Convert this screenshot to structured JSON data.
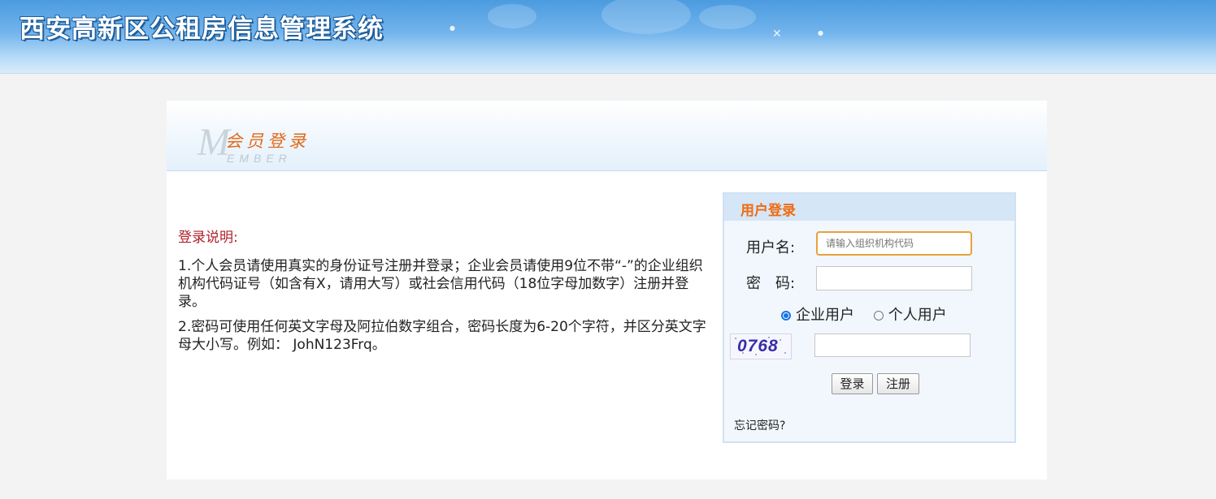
{
  "header": {
    "title": "西安高新区公租房信息管理系统"
  },
  "panel": {
    "logo_letter": "M",
    "logo_cn": "会员登录",
    "logo_en": "EMBER"
  },
  "instructions": {
    "title": "登录说明:",
    "items": [
      "1.个人会员请使用真实的身份证号注册并登录；企业会员请使用9位不带“-”的企业组织机构代码证号（如含有X，请用大写）或社会信用代码（18位字母加数字）注册并登录。",
      "2.密码可使用任何英文字母及阿拉伯数字组合，密码长度为6-20个字符，并区分英文字母大小写。例如： JohN123Frq。"
    ]
  },
  "login": {
    "title": "用户登录",
    "username_label": "用户名:",
    "username_placeholder": "请输入组织机构代码",
    "password_label": "密　码:",
    "options": {
      "enterprise": "企业用户",
      "personal": "个人用户",
      "selected": "企业用户"
    },
    "captcha_text": "0768",
    "login_button": "登录",
    "register_button": "注册",
    "forgot_link": "忘记密码?"
  },
  "colors": {
    "accent": "#f06a10",
    "instruction_title": "#b0202a",
    "banner": "#4b9be0"
  }
}
